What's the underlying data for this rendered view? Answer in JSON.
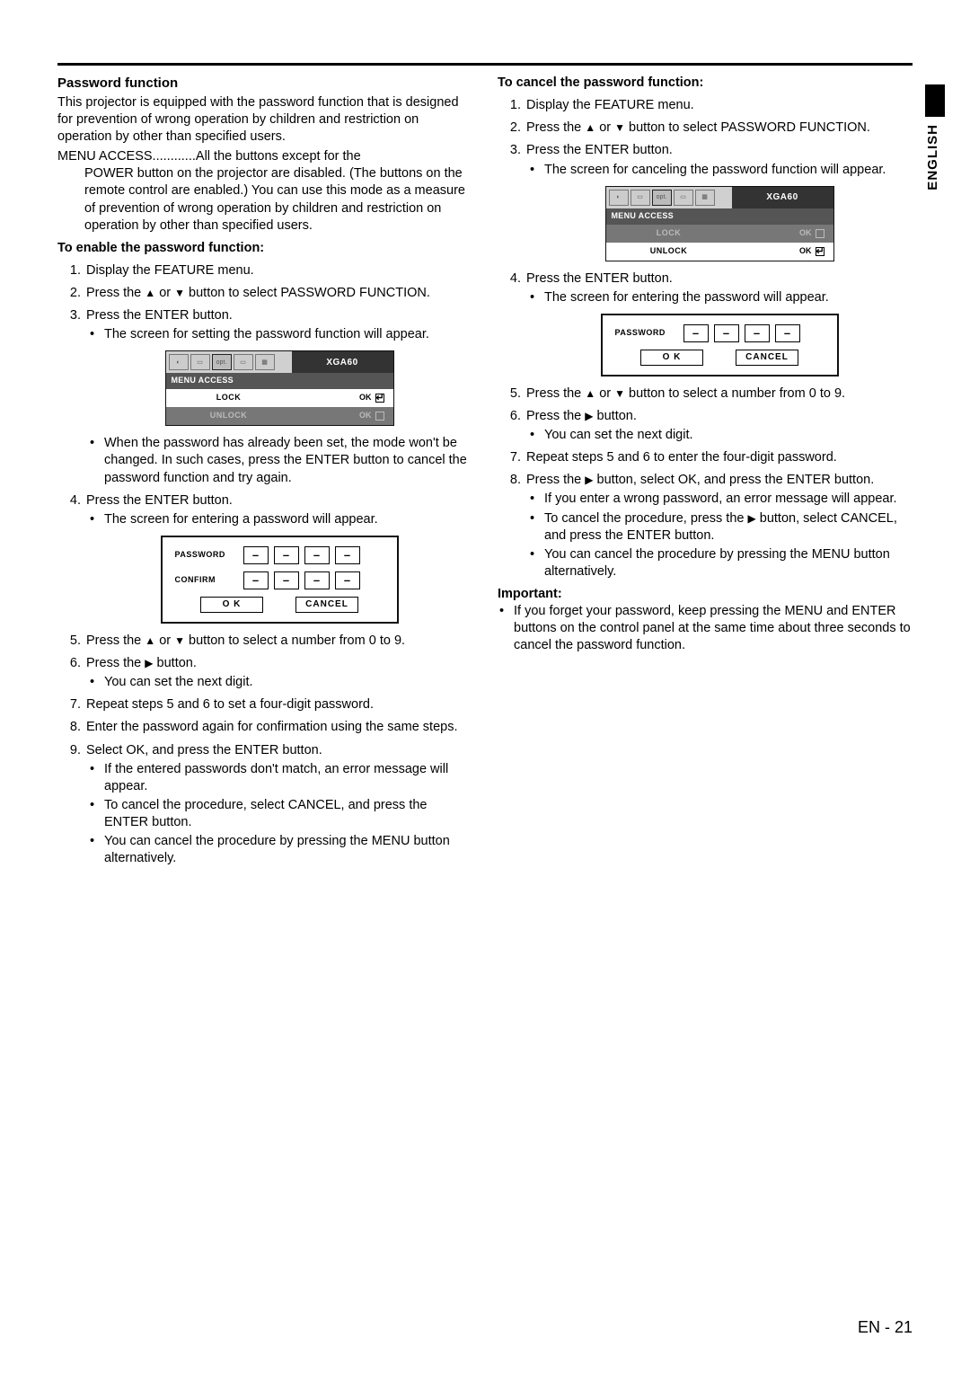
{
  "sideTab": {
    "lang": "ENGLISH"
  },
  "footer": {
    "label": "EN - 21"
  },
  "menuFig": {
    "signal": "XGA60",
    "title": "MENU ACCESS",
    "optLabel": "opt.",
    "lock": {
      "label": "LOCK",
      "ok": "OK"
    },
    "unlock": {
      "label": "UNLOCK",
      "ok": "OK"
    }
  },
  "pwFig": {
    "pwLabel": "PASSWORD",
    "confirmLabel": "CONFIRM",
    "digit": "–",
    "ok": "O K",
    "cancel": "CANCEL"
  },
  "left": {
    "title": "Password function",
    "intro": "This projector is equipped with the password function that is designed for prevention of wrong operation by children and restriction on operation by other than specified users.",
    "menuAccessLabel": "MENU ACCESS............",
    "menuAccessBody": "All the buttons except for the POWER button on the projector are disabled. (The buttons on the remote control are enabled.) You can use this mode as a measure of prevention of wrong operation by children and restriction on operation by other than specified users.",
    "enableTitle": "To enable the password function:",
    "s1": "Display the FEATURE menu.",
    "s2a": "Press the ",
    "s2b": " or ",
    "s2c": " button to select PASSWORD FUNCTION.",
    "s3": "Press the ENTER button.",
    "s3b1": "The screen for setting the password function will appear.",
    "s3b2": "When the password has already been set, the mode won't be changed. In such cases, press the ENTER button to cancel the password function and try again.",
    "s4": "Press the ENTER button.",
    "s4b1": "The screen for entering a password will appear.",
    "s5a": "Press the ",
    "s5b": " or ",
    "s5c": " button to select a number from 0 to 9.",
    "s6a": "Press the ",
    "s6b": " button.",
    "s6bul": "You can set the next digit.",
    "s7": "Repeat steps 5 and 6 to set a four-digit password.",
    "s8": "Enter the password again for confirmation using the same steps.",
    "s9": "Select OK, and press the ENTER button.",
    "s9b1": "If the entered passwords don't match, an error message will appear.",
    "s9b2": "To cancel the procedure, select CANCEL, and press the ENTER button.",
    "s9b3": "You can cancel the procedure by pressing the MENU button alternatively."
  },
  "right": {
    "cancelTitle": "To cancel the password function:",
    "s1": "Display the FEATURE menu.",
    "s2a": "Press the ",
    "s2b": " or ",
    "s2c": " button to select PASSWORD FUNCTION.",
    "s3": "Press the ENTER button.",
    "s3b1": "The screen for canceling the password function will appear.",
    "s4": "Press the ENTER button.",
    "s4b1": "The screen for entering the password will appear.",
    "s5a": "Press the ",
    "s5b": " or ",
    "s5c": " button to select a number from 0 to 9.",
    "s6a": "Press the ",
    "s6b": " button.",
    "s6bul": "You can set the next digit.",
    "s7": "Repeat steps 5 and 6 to enter the four-digit password.",
    "s8a": "Press the ",
    "s8b": " button, select OK, and press the ENTER button.",
    "s8bul1": "If you enter a wrong password, an error message will appear.",
    "s8bul2a": "To cancel the procedure, press the ",
    "s8bul2b": " button, select CANCEL, and press the ENTER button.",
    "s8bul3": "You can cancel the procedure by pressing the MENU button alternatively.",
    "importantTitle": "Important:",
    "importantBody": "If you forget your password, keep pressing the MENU and ENTER buttons on the control panel at the same time about three seconds to cancel the password function."
  }
}
